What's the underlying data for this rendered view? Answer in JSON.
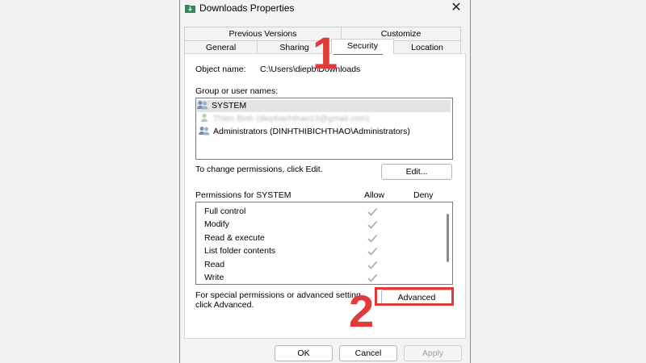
{
  "window": {
    "title": "Downloads Properties",
    "close_glyph": "✕",
    "title_icon": "folder-download-icon"
  },
  "tabs_row1": [
    {
      "label": "Previous Versions"
    },
    {
      "label": "Customize"
    }
  ],
  "tabs_row2": [
    {
      "label": "General"
    },
    {
      "label": "Sharing"
    },
    {
      "label": "Security",
      "active": true
    },
    {
      "label": "Location"
    }
  ],
  "security": {
    "object_label": "Object name:",
    "object_value": "C:\\Users\\diepb\\Downloads",
    "group_label": "Group or user names:",
    "users": [
      {
        "name": "SYSTEM",
        "selected": true
      },
      {
        "name": "Thien Binh (diepbachthao13@gmail.com)",
        "blurred": true
      },
      {
        "name": "Administrators (DINHTHIBICHTHAO\\Administrators)"
      }
    ],
    "change_hint": "To change permissions, click Edit.",
    "edit_button": "Edit...",
    "permissions_label": "Permissions for SYSTEM",
    "allow_header": "Allow",
    "deny_header": "Deny",
    "permissions": [
      {
        "name": "Full control",
        "allow": true,
        "deny": false
      },
      {
        "name": "Modify",
        "allow": true,
        "deny": false
      },
      {
        "name": "Read & execute",
        "allow": true,
        "deny": false
      },
      {
        "name": "List folder contents",
        "allow": true,
        "deny": false
      },
      {
        "name": "Read",
        "allow": true,
        "deny": false
      },
      {
        "name": "Write",
        "allow": true,
        "deny": false
      }
    ],
    "special_hint_line1": "For special permissions or advanced setting",
    "special_hint_line2": "click Advanced.",
    "advanced_button": "Advanced"
  },
  "footer": {
    "ok": "OK",
    "cancel": "Cancel",
    "apply": "Apply"
  },
  "annotations": {
    "step1": "1",
    "step2": "2",
    "color": "#e03a3a"
  }
}
